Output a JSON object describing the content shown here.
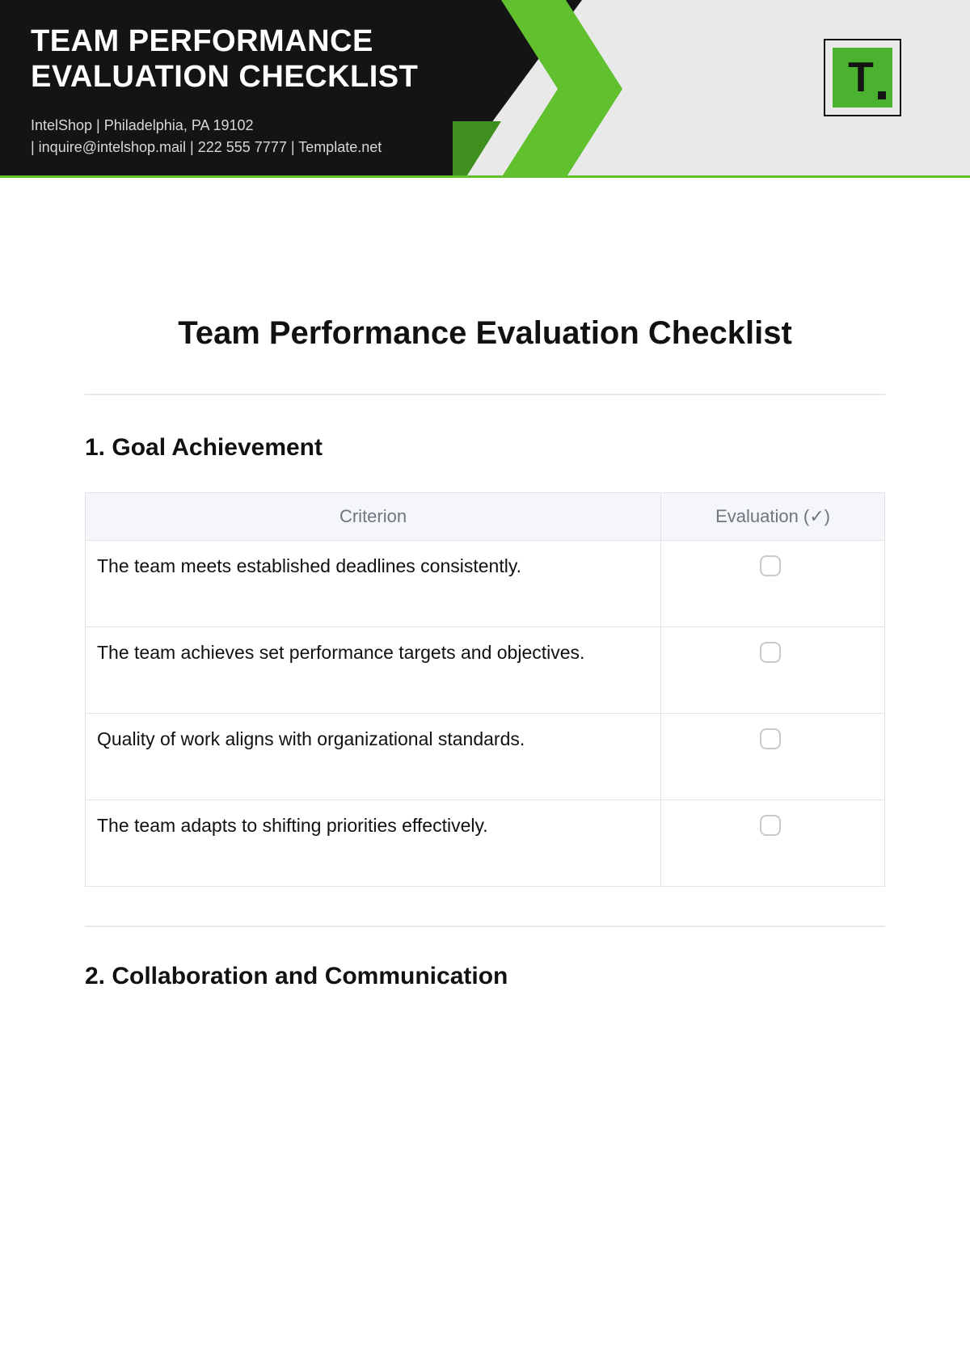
{
  "header": {
    "title_line1": "TEAM PERFORMANCE",
    "title_line2": "EVALUATION CHECKLIST",
    "meta_line1": "IntelShop | Philadelphia, PA 19102",
    "meta_line2": "| inquire@intelshop.mail | 222 555 7777 | Template.net",
    "logo_letter": "T"
  },
  "document": {
    "title": "Team Performance Evaluation Checklist"
  },
  "section1": {
    "heading": "1. Goal Achievement",
    "columns": {
      "criterion": "Criterion",
      "evaluation": "Evaluation (✓)"
    },
    "rows": [
      {
        "criterion": "The team meets established deadlines consistently."
      },
      {
        "criterion": "The team achieves set performance targets and objectives."
      },
      {
        "criterion": "Quality of work aligns with organizational standards."
      },
      {
        "criterion": "The team adapts to shifting priorities effectively."
      }
    ]
  },
  "section2": {
    "heading": "2. Collaboration and Communication"
  }
}
